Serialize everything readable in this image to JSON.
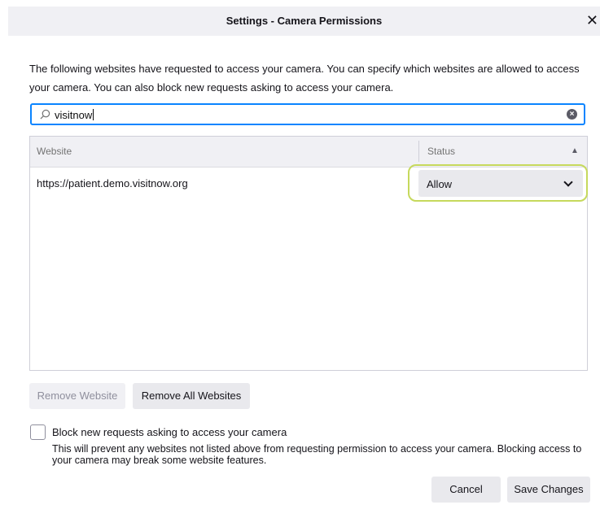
{
  "window": {
    "title": "Settings - Camera Permissions",
    "close_glyph": "✕"
  },
  "description": "The following websites have requested to access your camera. You can specify which websites are allowed to access your camera. You can also block new requests asking to access your camera.",
  "search": {
    "value": "visitnow",
    "icon": "search-icon",
    "clear_icon": "clear-icon"
  },
  "table": {
    "columns": [
      "Website",
      "Status"
    ],
    "sort_indicator": "▲",
    "rows": [
      {
        "website": "https://patient.demo.visitnow.org",
        "status": "Allow"
      }
    ]
  },
  "buttons": {
    "remove_website": "Remove Website",
    "remove_all": "Remove All Websites",
    "cancel": "Cancel",
    "save": "Save Changes"
  },
  "block": {
    "checked": false,
    "label": "Block new requests asking to access your camera",
    "description": "This will prevent any websites not listed above from requesting permission to access your camera. Blocking access to your camera may break some website features."
  },
  "colors": {
    "focus": "#0a84ff",
    "highlight": "#c6d95c"
  }
}
